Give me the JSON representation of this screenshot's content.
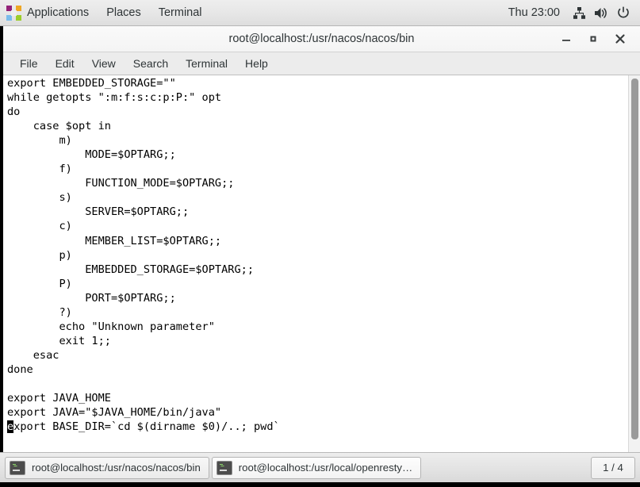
{
  "top_panel": {
    "apps_label": "Applications",
    "places_label": "Places",
    "terminal_label": "Terminal",
    "clock": "Thu 23:00",
    "icons": [
      "distro-pinwheel-icon",
      "network-icon",
      "volume-icon",
      "power-icon"
    ]
  },
  "window": {
    "title": "root@localhost:/usr/nacos/nacos/bin",
    "controls": {
      "minimize": "minimize-button",
      "maximize": "maximize-button",
      "close": "close-button"
    }
  },
  "menubar": {
    "items": [
      {
        "label": "File"
      },
      {
        "label": "Edit"
      },
      {
        "label": "View"
      },
      {
        "label": "Search"
      },
      {
        "label": "Terminal"
      },
      {
        "label": "Help"
      }
    ]
  },
  "terminal": {
    "lines": [
      "export EMBEDDED_STORAGE=\"\"",
      "while getopts \":m:f:s:c:p:P:\" opt",
      "do",
      "    case $opt in",
      "        m)",
      "            MODE=$OPTARG;;",
      "        f)",
      "            FUNCTION_MODE=$OPTARG;;",
      "        s)",
      "            SERVER=$OPTARG;;",
      "        c)",
      "            MEMBER_LIST=$OPTARG;;",
      "        p)",
      "            EMBEDDED_STORAGE=$OPTARG;;",
      "        P)",
      "            PORT=$OPTARG;;",
      "        ?)",
      "        echo \"Unknown parameter\"",
      "        exit 1;;",
      "    esac",
      "done",
      "",
      "export JAVA_HOME",
      "export JAVA=\"$JAVA_HOME/bin/java\""
    ],
    "cursor_line": {
      "cursor_char": "e",
      "rest": "xport BASE_DIR=`cd $(dirname $0)/..; pwd`"
    }
  },
  "taskbar": {
    "items": [
      {
        "label": "root@localhost:/usr/nacos/nacos/bin",
        "icon": "terminal-icon",
        "active": true
      },
      {
        "label": "root@localhost:/usr/local/openresty…",
        "icon": "terminal-icon",
        "active": false
      }
    ],
    "workspace": "1 / 4"
  },
  "colors": {
    "panel_bg": "#e6e6e6",
    "title_bg": "#f6f6f6",
    "menu_bg": "#ececec",
    "terminal_bg": "#ffffff",
    "terminal_fg": "#000000",
    "taskbar_bg": "#e4e4e4",
    "window_border": "#000000"
  }
}
